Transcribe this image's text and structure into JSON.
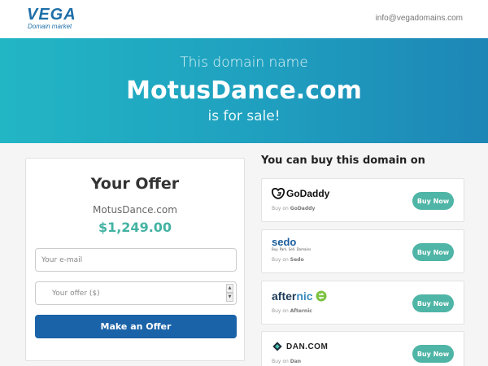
{
  "header": {
    "logo_main": "VEGA",
    "logo_sub": "Domain market",
    "contact_email": "info@vegadomains.com"
  },
  "hero": {
    "line1": "This domain name",
    "domain": "MotusDance.com",
    "line3": "is for sale!"
  },
  "offer": {
    "title": "Your Offer",
    "domain": "MotusDance.com",
    "price": "$1,249.00",
    "email_placeholder": "Your e-mail",
    "offer_placeholder": "Your offer ($)",
    "submit_label": "Make an Offer"
  },
  "buy": {
    "heading": "You can buy this domain on",
    "vendors": [
      {
        "name": "GoDaddy",
        "logo_text": "GoDaddy",
        "buy_on": "Buy on",
        "button": "Buy Now"
      },
      {
        "name": "Sedo",
        "logo_text": "sedo",
        "tagline": "Buy. Park. Sell. Domains",
        "buy_on": "Buy on",
        "button": "Buy Now"
      },
      {
        "name": "Afternic",
        "logo_text_a": "after",
        "logo_text_b": "nic",
        "buy_on": "Buy on",
        "button": "Buy Now"
      },
      {
        "name": "Dan",
        "logo_text": "DAN.COM",
        "buy_on": "Buy on",
        "button": "Buy Now"
      }
    ]
  },
  "colors": {
    "brand": "#1e6fa8",
    "hero_start": "#22b6c5",
    "hero_end": "#1d86b6",
    "price": "#44b3a3",
    "submit": "#1a63a8",
    "buy_button": "#4fb5a6"
  }
}
